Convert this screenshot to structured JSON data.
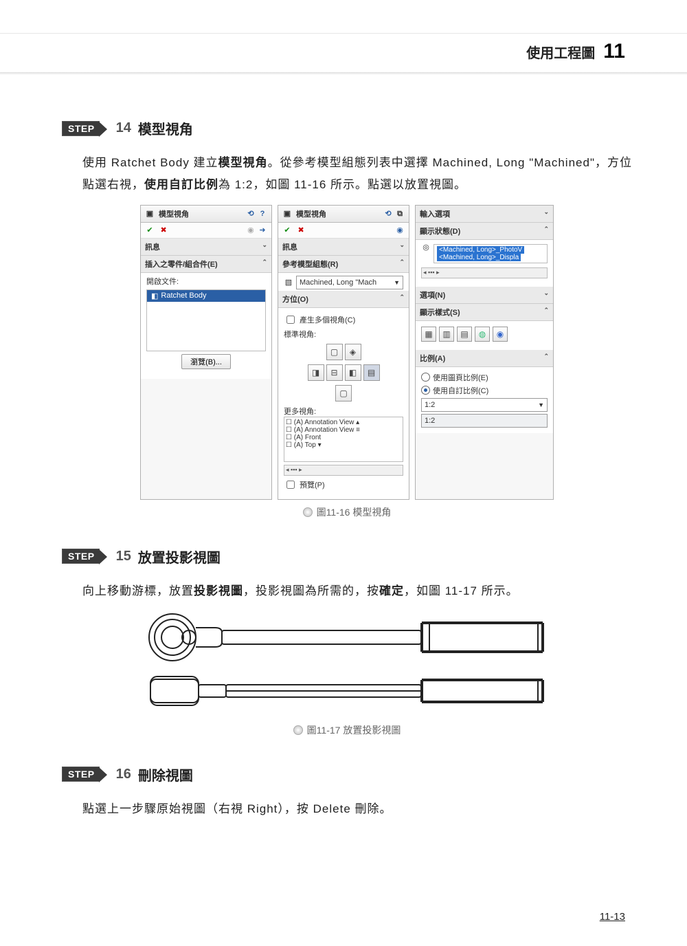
{
  "header": {
    "title": "使用工程圖",
    "chapter": "11"
  },
  "page_number": "11-13",
  "step14": {
    "num": "14",
    "title": "模型視角",
    "paragraph_pre": "使用 Ratchet Body 建立",
    "paragraph_bold1": "模型視角",
    "paragraph_mid": "。從參考模型組態列表中選擇 Machined, Long \"Machined\"，方位點選右視，",
    "paragraph_bold2": "使用自訂比例",
    "paragraph_post": "為 1:2，如圖 11-16 所示。點選以放置視圖。"
  },
  "fig16": {
    "caption": "圖11-16  模型視角",
    "panel_left": {
      "title": "模型視角",
      "info": "訊息",
      "insert_section": "插入之零件/組合件(E)",
      "open_doc": "開啟文件:",
      "selected_item": "Ratchet Body",
      "browse": "瀏覽(B)..."
    },
    "panel_mid": {
      "title": "模型視角",
      "info": "訊息",
      "ref_config": "參考模型組態(R)",
      "config_value": "Machined, Long \"Mach",
      "orientation": "方位(O)",
      "multi_view": "產生多個視角(C)",
      "std_view": "標準視角:",
      "more_views": "更多視角:",
      "mv_items": [
        "(A) Annotation View",
        "(A) Annotation View",
        "(A) Front",
        "(A) Top"
      ],
      "preview": "預覽(P)"
    },
    "panel_right": {
      "import_opts": "輸入選項",
      "disp_state": "顯示狀態(D)",
      "ds_opt1": "<Machined, Long>_PhotoV",
      "ds_opt2": "<Machined, Long>_Displa",
      "options": "選項(N)",
      "disp_style": "顯示樣式(S)",
      "scale": "比例(A)",
      "use_page": "使用圖頁比例(E)",
      "use_custom": "使用自訂比例(C)",
      "scale_value": "1:2",
      "scale_dd": "1:2"
    }
  },
  "step15": {
    "num": "15",
    "title": "放置投影視圖",
    "paragraph_pre": "向上移動游標，放置",
    "paragraph_bold1": "投影視圖",
    "paragraph_mid": "，投影視圖為所需的，按",
    "paragraph_bold2": "確定",
    "paragraph_post": "，如圖 11-17 所示。"
  },
  "fig17_caption": "圖11-17 放置投影視圖",
  "step16": {
    "num": "16",
    "title": "刪除視圖",
    "paragraph": "點選上一步驟原始視圖（右視 Right），按 Delete 刪除。"
  }
}
